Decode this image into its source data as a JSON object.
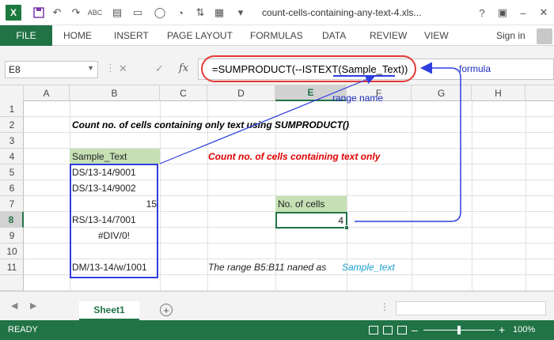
{
  "app": {
    "doc_title": "count-cells-containing-any-text-4.xls...",
    "logo_letter": "X",
    "help": "?",
    "ribbon_toggle": "▣",
    "minimize": "–",
    "close": "✕"
  },
  "ribbon": {
    "file": "FILE",
    "tabs": [
      "HOME",
      "INSERT",
      "PAGE LAYOUT",
      "FORMULAS",
      "DATA",
      "REVIEW",
      "VIEW"
    ],
    "sign_in": "Sign in"
  },
  "formula_bar": {
    "name_box": "E8",
    "cancel": "✕",
    "enter": "✓",
    "fx": "fx",
    "formula": "=SUMPRODUCT(--ISTEXT(Sample_Text))",
    "annotation_formula": "formula",
    "annotation_range": "range name"
  },
  "grid": {
    "columns": [
      "A",
      "B",
      "C",
      "D",
      "E",
      "F",
      "G",
      "H"
    ],
    "rows": [
      "1",
      "2",
      "3",
      "4",
      "5",
      "6",
      "7",
      "8",
      "9",
      "10",
      "11"
    ],
    "selected_column": "E",
    "selected_row": "8",
    "cells": {
      "B2": "Count no. of cells  containing only text using SUMPRODUCT()",
      "B4": "Sample_Text",
      "D4": "Count no. of cells containing text only",
      "B5": "DS/13-14/9001",
      "B6": "DS/13-14/9002",
      "B7": "15",
      "E7": "No. of cells",
      "B8": "RS/13-14/7001",
      "E8": "4",
      "B9": "#DIV/0!",
      "B11": "DM/13-14/w/1001",
      "D11": "The range B5:B11 naned as",
      "F11": "Sample_text"
    }
  },
  "sheets": {
    "active": "Sheet1",
    "add_label": "+",
    "prev": "◀",
    "next": "▶"
  },
  "status": {
    "ready": "READY",
    "zoom": "100%",
    "minus": "–",
    "plus": "+"
  },
  "colors": {
    "excel_green": "#217346",
    "header_fill": "#c6e0b4",
    "red_text": "#e00000",
    "annotation_blue": "#2f3ee0",
    "oval_red": "#e53935"
  }
}
